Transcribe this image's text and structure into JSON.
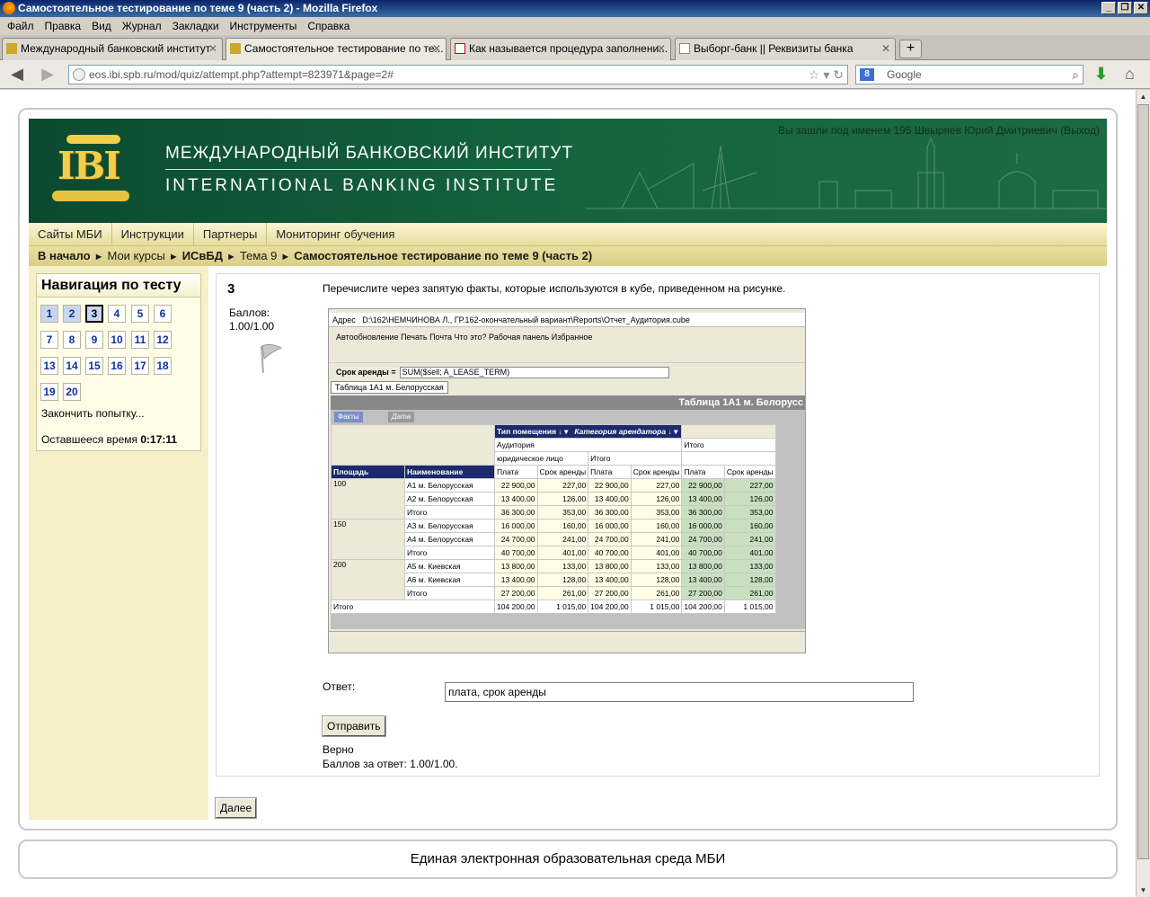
{
  "window": {
    "title": "Самостоятельное тестирование по теме 9 (часть 2) - Mozilla Firefox",
    "minimize": "_",
    "restore": "❐",
    "close": "✕"
  },
  "menu": [
    "Файл",
    "Правка",
    "Вид",
    "Журнал",
    "Закладки",
    "Инструменты",
    "Справка"
  ],
  "tabs": [
    {
      "label": "Международный банковский институт",
      "close": "✕"
    },
    {
      "label": "Самостоятельное тестирование по те...",
      "close": "✕"
    },
    {
      "label": "Как называется процедура заполнени...",
      "close": "✕"
    },
    {
      "label": "Выборг-банк || Реквизиты банка",
      "close": "✕"
    }
  ],
  "new_tab": "+",
  "navbar": {
    "url": "eos.ibi.spb.ru/mod/quiz/attempt.php?attempt=823971&page=2#",
    "search_placeholder": "Google"
  },
  "header": {
    "logo_text": "IBI",
    "name_ru": "МЕЖДУНАРОДНЫЙ БАНКОВСКИЙ ИНСТИТУТ",
    "name_en": "INTERNATIONAL BANKING INSTITUTE",
    "login_info": "Вы зашли под именем 195 Швыряев Юрий Дмитриевич (Выход)"
  },
  "topnav": [
    "Сайты МБИ",
    "Инструкции",
    "Партнеры",
    "Мониторинг обучения"
  ],
  "breadcrumb": {
    "home": "В начало",
    "courses": "Мои курсы",
    "course": "ИСвБД",
    "topic": "Тема 9",
    "current": "Самостоятельное тестирование по теме 9 (часть 2)",
    "sep": "►"
  },
  "quiz_nav": {
    "title": "Навигация по тесту",
    "questions": [
      "1",
      "2",
      "3",
      "4",
      "5",
      "6",
      "7",
      "8",
      "9",
      "10",
      "11",
      "12",
      "13",
      "14",
      "15",
      "16",
      "17",
      "18",
      "19",
      "20"
    ],
    "finish": "Закончить попытку...",
    "time_label": "Оставшееся время",
    "time_value": "0:17:11"
  },
  "question": {
    "number": "3",
    "grade_label": "Баллов:",
    "grade_value": "1.00/1.00",
    "text": "Перечислите через запятую факты, которые используются  в кубе, приведенном на рисунке.",
    "answer_label": "Ответ:",
    "answer_value": "плата, срок аренды",
    "submit": "Отправить",
    "feedback_status": "Верно",
    "feedback_grade": "Баллов за ответ: 1.00/1.00."
  },
  "cube": {
    "addr_label": "Адрес",
    "addr_path": "D:\\162\\НЕМЧИНОВА Л., ГР.162-окончательный вариант\\Reports\\Отчет_Аудитория.cube",
    "toolbar1": "Автообновление   Печать   Почта   Что это?   Рабочая панель   Избранное",
    "formula_label": "Срок аренды =",
    "formula": "SUM($sell; A_LEASE_TERM)",
    "sheet": "Таблица 1А1 м. Белорусская",
    "table_title": "Таблица 1А1 м. Белорусс",
    "facts_btn": "Факты",
    "date_btn": "Дата",
    "col_dim1": "Тип помещения",
    "col_dim2": "Категория арендатора",
    "audience": "Аудитория",
    "legal": "юридическое лицо",
    "total": "Итого",
    "row_dim1": "Площадь",
    "row_dim2": "Наименование",
    "pay": "Плата",
    "term": "Срок аренды",
    "rows": [
      {
        "area": "100",
        "name": "А1 м. Белорусская",
        "v": [
          "22 900,00",
          "227,00",
          "22 900,00",
          "227,00",
          "22 900,00",
          "227,00"
        ]
      },
      {
        "area": "",
        "name": "А2 м. Белорусская",
        "v": [
          "13 400,00",
          "126,00",
          "13 400,00",
          "126,00",
          "13 400,00",
          "126,00"
        ]
      },
      {
        "area": "",
        "name": "Итого",
        "v": [
          "36 300,00",
          "353,00",
          "36 300,00",
          "353,00",
          "36 300,00",
          "353,00"
        ]
      },
      {
        "area": "150",
        "name": "А3 м. Белорусская",
        "v": [
          "16 000,00",
          "160,00",
          "16 000,00",
          "160,00",
          "16 000,00",
          "160,00"
        ]
      },
      {
        "area": "",
        "name": "А4 м. Белорусская",
        "v": [
          "24 700,00",
          "241,00",
          "24 700,00",
          "241,00",
          "24 700,00",
          "241,00"
        ]
      },
      {
        "area": "",
        "name": "Итого",
        "v": [
          "40 700,00",
          "401,00",
          "40 700,00",
          "401,00",
          "40 700,00",
          "401,00"
        ]
      },
      {
        "area": "200",
        "name": "А5 м. Киевская",
        "v": [
          "13 800,00",
          "133,00",
          "13 800,00",
          "133,00",
          "13 800,00",
          "133,00"
        ]
      },
      {
        "area": "",
        "name": "А6 м. Киевская",
        "v": [
          "13 400,00",
          "128,00",
          "13 400,00",
          "128,00",
          "13 400,00",
          "128,00"
        ]
      },
      {
        "area": "",
        "name": "Итого",
        "v": [
          "27 200,00",
          "261,00",
          "27 200,00",
          "261,00",
          "27 200,00",
          "261,00"
        ]
      }
    ],
    "grand": {
      "label": "Итого",
      "v": [
        "104 200,00",
        "1 015,00",
        "104 200,00",
        "1 015,00",
        "104 200,00",
        "1 015,00"
      ]
    }
  },
  "next": "Далее",
  "footer": "Единая электронная образовательная среда МБИ"
}
